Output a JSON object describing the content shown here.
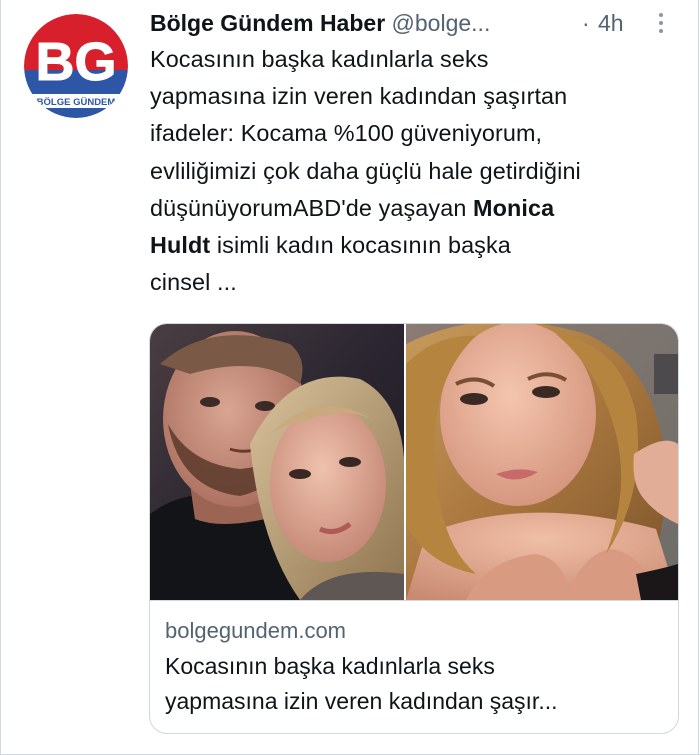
{
  "tweet": {
    "author_name": "Bölge Gündem Haber",
    "author_handle": "@bolge...",
    "separator": "·",
    "time": "4h",
    "more_icon": "more-dots-icon",
    "text_lines": [
      "Kocasının başka kadınlarla seks",
      "yapmasına izin veren kadından şaşırtan",
      "ifadeler: Kocama %100 güveniyorum,",
      "evliliğimizi çok daha güçlü hale getirdiğini"
    ],
    "text_line5_pre": "düşünüyorumABD'de yaşayan ",
    "text_line5_bold": "Monica",
    "text_line6_bold": "Huldt",
    "text_line6_post": " isimli kadın kocasının başka",
    "text_line7": "cinsel ..."
  },
  "avatar": {
    "logo_letters": "BG",
    "logo_caption": "BÖLGE GÜNDEM",
    "colors": {
      "red": "#d7202b",
      "blue": "#2d56a6",
      "white": "#ffffff"
    }
  },
  "card": {
    "domain": "bolgegundem.com",
    "title_lines": [
      "Kocasının başka kadınlarla seks",
      "yapmasına izin veren kadından şaşır..."
    ]
  },
  "colors": {
    "text_primary": "#0f1419",
    "text_secondary": "#536471",
    "border": "#cfd9de"
  }
}
